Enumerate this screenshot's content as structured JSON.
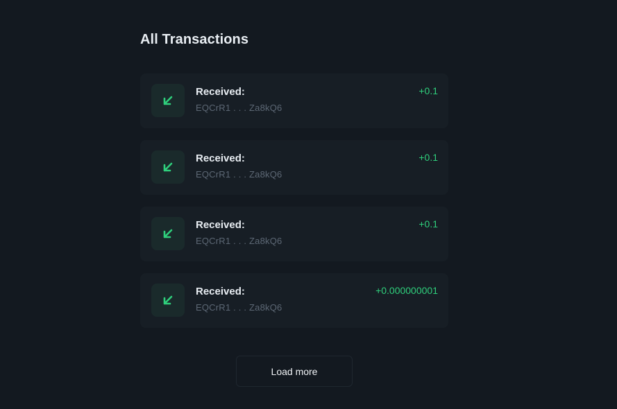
{
  "header": {
    "title": "All Transactions"
  },
  "transactions": [
    {
      "label": "Received:",
      "address": "EQCrR1 . . . Za8kQ6",
      "amount": "+0.1",
      "icon": "arrow-down-left-icon"
    },
    {
      "label": "Received:",
      "address": "EQCrR1 . . . Za8kQ6",
      "amount": "+0.1",
      "icon": "arrow-down-left-icon"
    },
    {
      "label": "Received:",
      "address": "EQCrR1 . . . Za8kQ6",
      "amount": "+0.1",
      "icon": "arrow-down-left-icon"
    },
    {
      "label": "Received:",
      "address": "EQCrR1 . . . Za8kQ6",
      "amount": "+0.000000001",
      "icon": "arrow-down-left-icon"
    }
  ],
  "actions": {
    "load_more_label": "Load more"
  },
  "colors": {
    "background": "#131920",
    "card": "#171e25",
    "accent_green": "#2fcf7c",
    "muted_text": "#5d6875"
  }
}
